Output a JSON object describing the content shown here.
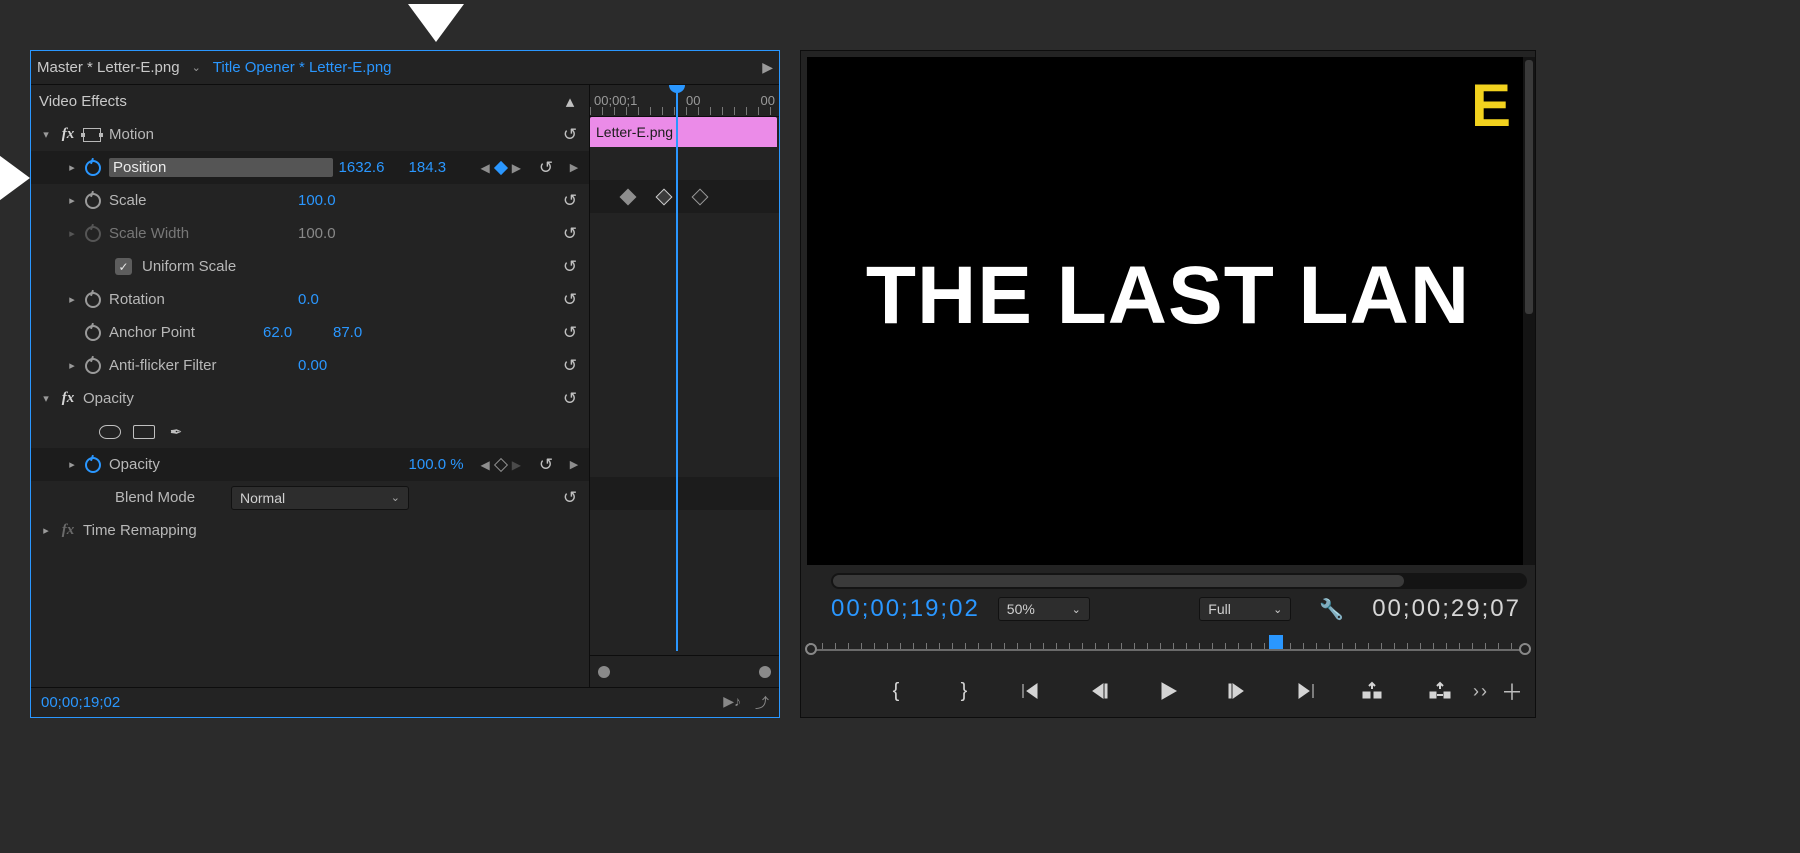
{
  "ec": {
    "master": "Master * Letter-E.png",
    "sequence": "Title Opener * Letter-E.png",
    "sectionLabel": "Video Effects",
    "mini": {
      "ruler_left": "00;00;1",
      "ruler_right": "00",
      "ruler_center_suffix": "00",
      "clip": "Letter-E.png"
    },
    "motion": {
      "label": "Motion",
      "position": {
        "label": "Position",
        "x": "1632.6",
        "y": "184.3"
      },
      "scale": {
        "label": "Scale",
        "val": "100.0"
      },
      "scaleWidth": {
        "label": "Scale Width",
        "val": "100.0"
      },
      "uniform": {
        "label": "Uniform Scale"
      },
      "rotation": {
        "label": "Rotation",
        "val": "0.0"
      },
      "anchor": {
        "label": "Anchor Point",
        "x": "62.0",
        "y": "87.0"
      },
      "antiflicker": {
        "label": "Anti-flicker Filter",
        "val": "0.00"
      }
    },
    "opacity": {
      "label": "Opacity",
      "value": {
        "label": "Opacity",
        "val": "100.0 %"
      },
      "blend": {
        "label": "Blend Mode",
        "val": "Normal"
      }
    },
    "timeRemap": {
      "label": "Time Remapping"
    },
    "footer_tc": "00;00;19;02"
  },
  "pm": {
    "title_text": "THE LAST LAN",
    "letter": "E",
    "tc_current": "00;00;19;02",
    "zoom": "50%",
    "res": "Full",
    "tc_duration": "00;00;29;07"
  }
}
